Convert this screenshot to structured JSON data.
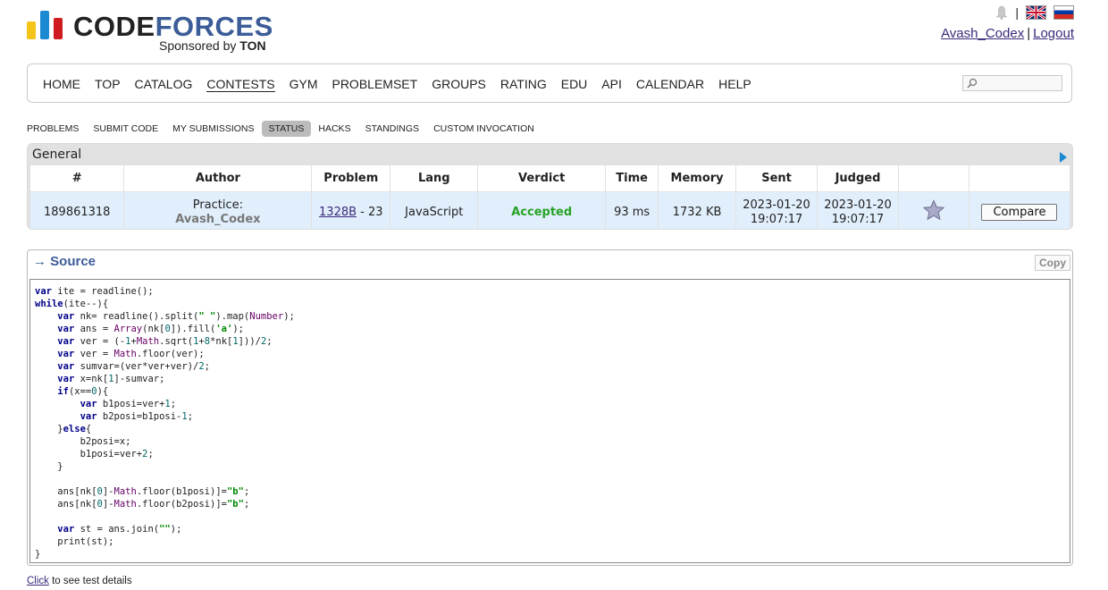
{
  "header": {
    "logo_word_main": "CODE",
    "logo_word_accent": "FORCES",
    "sponsor_prefix": "Sponsored by ",
    "sponsor_name": "TON",
    "username": "Avash_Codex",
    "logout_label": "Logout",
    "separator": "|"
  },
  "main_menu": [
    "HOME",
    "TOP",
    "CATALOG",
    "CONTESTS",
    "GYM",
    "PROBLEMSET",
    "GROUPS",
    "RATING",
    "EDU",
    "API",
    "CALENDAR",
    "HELP"
  ],
  "main_menu_active": "CONTESTS",
  "search": {
    "placeholder": ""
  },
  "sub_menu": [
    "PROBLEMS",
    "SUBMIT CODE",
    "MY SUBMISSIONS",
    "STATUS",
    "HACKS",
    "STANDINGS",
    "CUSTOM INVOCATION"
  ],
  "sub_menu_selected": "STATUS",
  "status": {
    "title": "General",
    "columns": [
      "#",
      "Author",
      "Problem",
      "Lang",
      "Verdict",
      "Time",
      "Memory",
      "Sent",
      "Judged",
      "",
      ""
    ],
    "row": {
      "id": "189861318",
      "author_prefix": "Practice:",
      "author_name": "Avash_Codex",
      "problem_link": "1328B",
      "problem_suffix": " - 23",
      "lang": "JavaScript",
      "verdict": "Accepted",
      "time": "93 ms",
      "memory": "1732 KB",
      "sent_date": "2023-01-20",
      "sent_time": "19:07:17",
      "judged_date": "2023-01-20",
      "judged_time": "19:07:17",
      "compare_label": "Compare"
    },
    "verdict_color": "#28a228"
  },
  "source": {
    "title": "→ Source",
    "copy_label": "Copy",
    "lines": [
      "var ite = readline();",
      "while(ite--){",
      "    var nk= readline().split(\" \").map(Number);",
      "    var ans = Array(nk[0]).fill('a');",
      "    var ver = (-1+Math.sqrt(1+8*nk[1]))/2;",
      "    var ver = Math.floor(ver);",
      "    var sumvar=(ver*ver+ver)/2;",
      "    var x=nk[1]-sumvar;",
      "    if(x==0){",
      "        var b1posi=ver+1;",
      "        var b2posi=b1posi-1;",
      "    }else{",
      "        b2posi=x;",
      "        b1posi=ver+2;",
      "    }",
      "",
      "    ans[nk[0]-Math.floor(b1posi)]=\"b\";",
      "    ans[nk[0]-Math.floor(b2posi)]=\"b\";",
      "",
      "    var st = ans.join(\"\");",
      "    print(st);",
      "}"
    ]
  },
  "footer": {
    "click_label": "Click",
    "click_suffix": " to see test details"
  }
}
